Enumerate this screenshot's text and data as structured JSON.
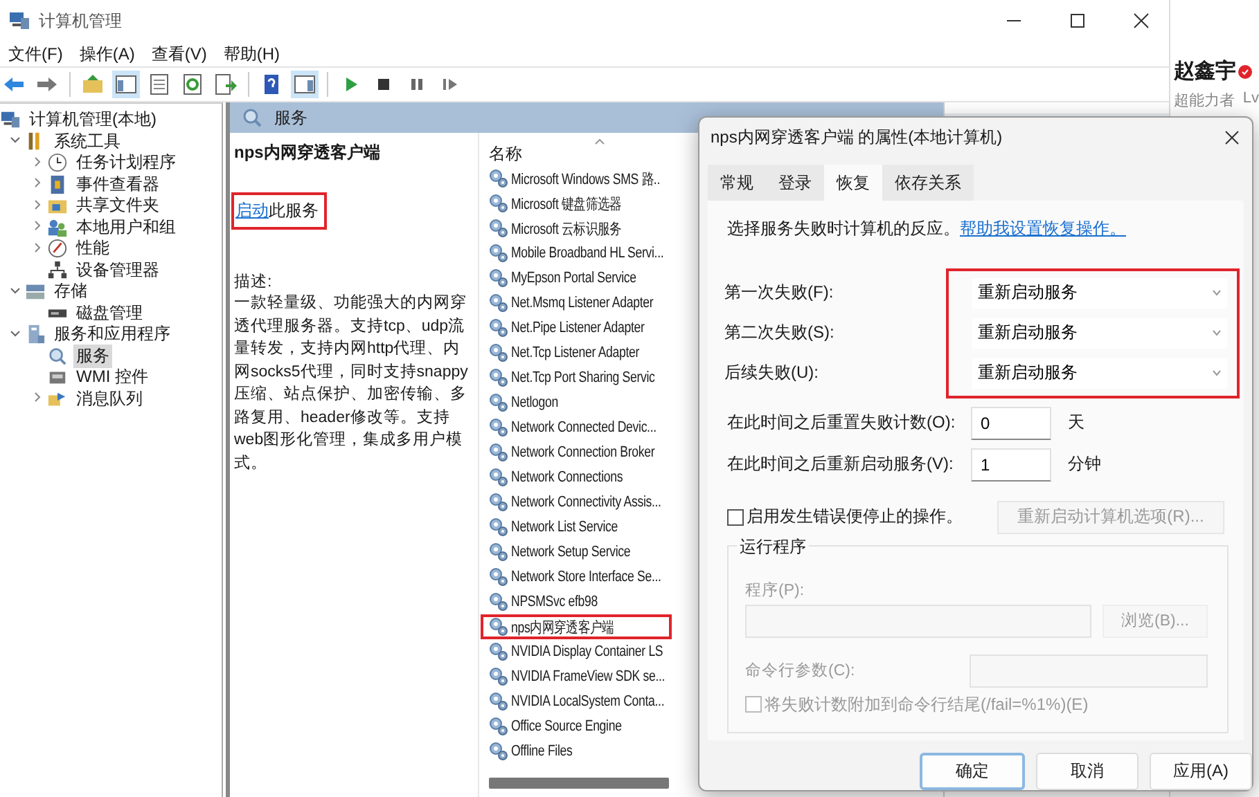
{
  "window": {
    "title": "计算机管理"
  },
  "menu": [
    "文件(F)",
    "操作(A)",
    "查看(V)",
    "帮助(H)"
  ],
  "toolbar": [
    {
      "pressed": false
    },
    {
      "pressed": false
    },
    {
      "pressed": false
    },
    {
      "pressed": true
    },
    {
      "pressed": false
    },
    {
      "pressed": false
    },
    {
      "pressed": false
    },
    {
      "pressed": false
    },
    {
      "pressed": true
    },
    {
      "pressed": false
    },
    {
      "pressed": false
    },
    {
      "pressed": false
    },
    {
      "pressed": false
    }
  ],
  "tree": [
    {
      "label": "计算机管理(本地)",
      "selected": false,
      "children": [
        {
          "label": "系统工具",
          "selected": false,
          "expanded": true,
          "children": [
            {
              "label": "任务计划程序",
              "selected": false,
              "expanded": false
            },
            {
              "label": "事件查看器",
              "selected": false,
              "expanded": false
            },
            {
              "label": "共享文件夹",
              "selected": false,
              "expanded": false
            },
            {
              "label": "本地用户和组",
              "selected": false,
              "expanded": false
            },
            {
              "label": "性能",
              "selected": false,
              "expanded": false
            },
            {
              "label": "设备管理器",
              "selected": false
            }
          ]
        },
        {
          "label": "存储",
          "selected": false,
          "expanded": true,
          "children": [
            {
              "label": "磁盘管理",
              "selected": false
            }
          ]
        },
        {
          "label": "服务和应用程序",
          "selected": false,
          "expanded": true,
          "children": [
            {
              "label": "服务",
              "selected": true
            },
            {
              "label": "WMI 控件",
              "selected": false
            },
            {
              "label": "消息队列",
              "selected": false,
              "expanded": false
            }
          ]
        }
      ]
    }
  ],
  "services_pane": {
    "header": "服务",
    "service_name": "nps内网穿透客户端",
    "start_link": "启动",
    "start_text": "此服务",
    "start_highlighted": true,
    "description_label": "描述:",
    "description": "一款轻量级、功能强大的内网穿透代理服务器。支持tcp、udp流量转发，支持内网http代理、内网socks5代理，同时支持snappy压缩、站点保护、加密传输、多路复用、header修改等。支持web图形化管理，集成多用户模式。"
  },
  "list": {
    "column": "名称",
    "rows": [
      {
        "name": "Microsoft Windows SMS 路..",
        "highlighted": false
      },
      {
        "name": "Microsoft 键盘筛选器",
        "highlighted": false
      },
      {
        "name": "Microsoft 云标识服务",
        "highlighted": false
      },
      {
        "name": "Mobile Broadband HL Servi...",
        "highlighted": false
      },
      {
        "name": "MyEpson Portal Service",
        "highlighted": false
      },
      {
        "name": "Net.Msmq Listener Adapter",
        "highlighted": false
      },
      {
        "name": "Net.Pipe Listener Adapter",
        "highlighted": false
      },
      {
        "name": "Net.Tcp Listener Adapter",
        "highlighted": false
      },
      {
        "name": "Net.Tcp Port Sharing Servic",
        "highlighted": false
      },
      {
        "name": "Netlogon",
        "highlighted": false
      },
      {
        "name": "Network Connected Devic...",
        "highlighted": false
      },
      {
        "name": "Network Connection Broker",
        "highlighted": false
      },
      {
        "name": "Network Connections",
        "highlighted": false
      },
      {
        "name": "Network Connectivity Assis...",
        "highlighted": false
      },
      {
        "name": "Network List Service",
        "highlighted": false
      },
      {
        "name": "Network Setup Service",
        "highlighted": false
      },
      {
        "name": "Network Store Interface Se...",
        "highlighted": false
      },
      {
        "name": "NPSMSvc efb98",
        "highlighted": false
      },
      {
        "name": "nps内网穿透客户端",
        "highlighted": true
      },
      {
        "name": "NVIDIA Display Container LS",
        "highlighted": false
      },
      {
        "name": "NVIDIA FrameView SDK se...",
        "highlighted": false
      },
      {
        "name": "NVIDIA LocalSystem Conta...",
        "highlighted": false
      },
      {
        "name": "Office  Source Engine",
        "highlighted": false
      },
      {
        "name": "Offline Files",
        "highlighted": false
      }
    ]
  },
  "side_page": {
    "user_name": "赵鑫宇",
    "user_title": "超能力者",
    "rank": "Lv"
  },
  "dialog": {
    "title": "nps内网穿透客户端 的属性(本地计算机)",
    "tabs": [
      {
        "label": "常规",
        "selected": false
      },
      {
        "label": "登录",
        "selected": false
      },
      {
        "label": "恢复",
        "selected": true
      },
      {
        "label": "依存关系",
        "selected": false
      }
    ],
    "intro": "选择服务失败时计算机的反应。",
    "help_link": "帮助我设置恢复操作。",
    "failures_highlighted": true,
    "failures": [
      {
        "label": "第一次失败(F):",
        "value": "重新启动服务"
      },
      {
        "label": "第二次失败(S):",
        "value": "重新启动服务"
      },
      {
        "label": "后续失败(U):",
        "value": "重新启动服务"
      }
    ],
    "delays": [
      {
        "label": "在此时间之后重置失败计数(O):",
        "value": "0",
        "unit": "天"
      },
      {
        "label": "在此时间之后重新启动服务(V):",
        "value": "1",
        "unit": "分钟"
      }
    ],
    "stop_on_error": {
      "label": "启用发生错误便停止的操作。",
      "checked": false
    },
    "restart_options_button": {
      "label": "重新启动计算机选项(R)...",
      "disabled": true
    },
    "run_program": {
      "title": "运行程序",
      "disabled": true,
      "program_label": "程序(P):",
      "browse_button": "浏览(B)...",
      "args_label": "命令行参数(C):",
      "append_fail": {
        "label": "将失败计数附加到命令行结尾(/fail=%1%)(E)",
        "checked": false
      }
    },
    "buttons": [
      {
        "label": "确定",
        "default": true
      },
      {
        "label": "取消",
        "default": false
      },
      {
        "label": "应用(A)",
        "default": false
      }
    ]
  }
}
